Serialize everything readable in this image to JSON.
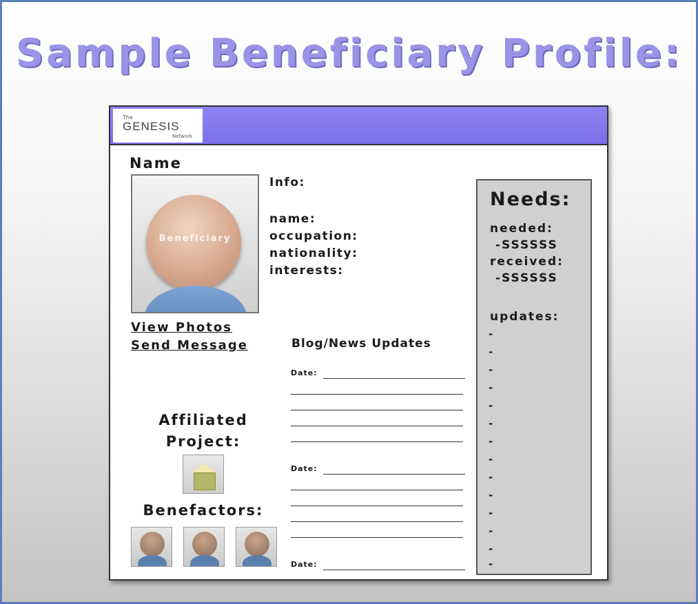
{
  "slide": {
    "title": "Sample Beneficiary Profile:"
  },
  "logo": {
    "the": "The",
    "main": "GENESIS",
    "network": "Network"
  },
  "profile": {
    "name_label": "Name",
    "photo_caption": "Beneficiary",
    "view_photos": "View Photos",
    "send_message": "Send Message",
    "info": {
      "heading": "Info:",
      "name": "name:",
      "occupation": "occupation:",
      "nationality": "nationality:",
      "interests": "interests:"
    },
    "affiliated_line1": "Affiliated",
    "affiliated_line2": "Project:",
    "benefactors_label": "Benefactors:"
  },
  "blog": {
    "title": "Blog/News Updates",
    "entries": [
      {
        "date_label": "Date:"
      },
      {
        "date_label": "Date:"
      },
      {
        "date_label": "Date:"
      }
    ]
  },
  "needs": {
    "title": "Needs:",
    "needed_label": "needed:",
    "needed_value": "-SSSSSS",
    "received_label": "received:",
    "received_value": "-SSSSSS",
    "updates_label": "updates:",
    "update_marker": "-"
  }
}
